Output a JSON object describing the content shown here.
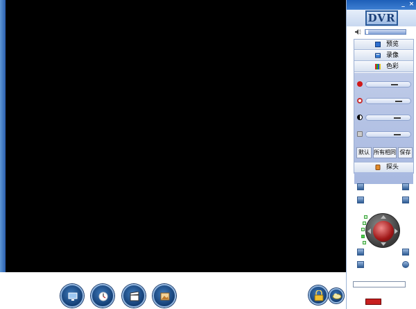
{
  "app": {
    "logo_text": "DVR"
  },
  "window_controls": {
    "minimize": "_",
    "close": "×"
  },
  "volume": {
    "level": 0.05
  },
  "tabs": [
    {
      "label": "预览",
      "icon": "preview-icon"
    },
    {
      "label": "录像",
      "icon": "record-icon"
    },
    {
      "label": "色彩",
      "icon": "color-icon"
    }
  ],
  "color_sliders": [
    {
      "name": "brightness",
      "icon": "brightness-icon",
      "icon_color": "#d01818",
      "value": 0.6
    },
    {
      "name": "contrast",
      "icon": "contrast-icon",
      "icon_color": "#c83030",
      "value": 0.7
    },
    {
      "name": "saturation",
      "icon": "saturation-icon",
      "icon_color": "#000000",
      "value": 0.65
    },
    {
      "name": "hue",
      "icon": "hue-icon",
      "icon_color": "#888888",
      "value": 0.65
    }
  ],
  "color_buttons": {
    "default": "默认",
    "all_same": "所有相同",
    "save": "保存"
  },
  "camera_tab": {
    "label": "探头"
  },
  "toolbar": {
    "tools": [
      "monitor-icon",
      "clock-icon",
      "clapper-icon",
      "gallery-icon"
    ],
    "right": [
      "lock-icon",
      "cloud-icon"
    ]
  },
  "status": {
    "badge": ""
  }
}
